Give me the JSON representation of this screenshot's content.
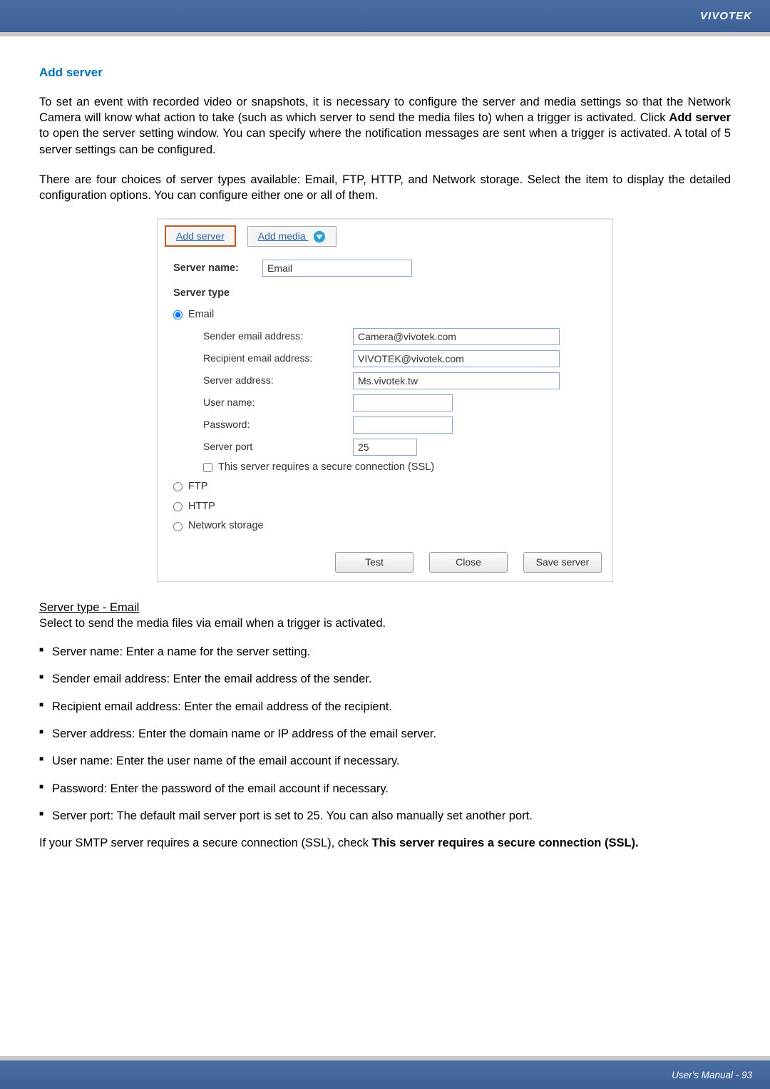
{
  "header": {
    "brand": "VIVOTEK"
  },
  "title": "Add server",
  "intro1_pre": "To set an event with recorded video or snapshots, it is necessary to configure the server and media settings so that the Network Camera will know what action to take (such as which server to send the media files to) when a trigger is activated. Click ",
  "intro1_bold": "Add server",
  "intro1_post": " to open the server setting window. You can specify where the notification messages are sent when a trigger is activated. A total of 5 server settings can be configured.",
  "intro2": "There are four choices of server types available: Email, FTP, HTTP, and Network storage. Select the item to display the detailed configuration options. You can configure either one or all of them.",
  "screenshot": {
    "tab_add_server": "Add server",
    "tab_add_media": "Add media",
    "server_name_label": "Server name:",
    "server_name_value": "Email",
    "server_type_label": "Server type",
    "radio_email": "Email",
    "radio_ftp": "FTP",
    "radio_http": "HTTP",
    "radio_network": "Network storage",
    "fields": {
      "sender_label": "Sender email address:",
      "sender_value": "Camera@vivotek.com",
      "recipient_label": "Recipient email address:",
      "recipient_value": "VIVOTEK@vivotek.com",
      "server_addr_label": "Server address:",
      "server_addr_value": "Ms.vivotek.tw",
      "user_label": "User name:",
      "user_value": "",
      "pass_label": "Password:",
      "pass_value": "",
      "port_label": "Server port",
      "port_value": "25"
    },
    "ssl_label": "This server requires a secure connection (SSL)",
    "buttons": {
      "test": "Test",
      "close": "Close",
      "save": "Save server"
    }
  },
  "subhead": "Server type - Email",
  "subdesc": "Select to send the media files via email when a trigger is activated.",
  "bullets": [
    "Server name: Enter a name for the server setting.",
    "Sender email address: Enter the email address of the sender.",
    "Recipient email address: Enter the email address of the recipient.",
    "Server address: Enter the domain name or IP address of the email server.",
    "User name: Enter the user name of the email account if necessary.",
    "Password: Enter the password of the email account if necessary.",
    "Server port: The default mail server port is set to 25. You can also manually set another port."
  ],
  "closing_pre": "If your SMTP server requires a secure connection (SSL), check ",
  "closing_bold": "This server requires a secure connection (SSL).",
  "footer": "User's Manual - 93"
}
